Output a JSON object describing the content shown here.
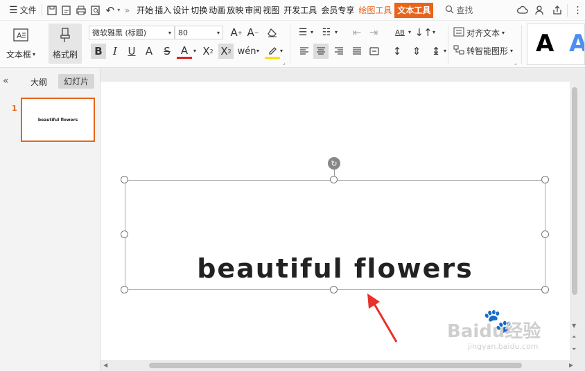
{
  "menu": {
    "label": "文件"
  },
  "tabs": [
    {
      "label": "开始"
    },
    {
      "label": "插入"
    },
    {
      "label": "设计"
    },
    {
      "label": "切换"
    },
    {
      "label": "动画"
    },
    {
      "label": "放映"
    },
    {
      "label": "审阅"
    },
    {
      "label": "视图"
    },
    {
      "label": "开发工具"
    },
    {
      "label": "会员专享"
    },
    {
      "label": "绘图工具"
    },
    {
      "label": "文本工具"
    }
  ],
  "search": {
    "label": "查找"
  },
  "ribbon": {
    "textbox_label": "文本框",
    "textbox_caret": "▾",
    "format_painter_label": "格式刷",
    "font_name": "微软雅黑 (标题)",
    "font_size": "80",
    "align_text_label": "对齐文本",
    "convert_smartart_label": "转智能图形",
    "style_glyph": "A"
  },
  "sidebar": {
    "outline_tab": "大纲",
    "slides_tab": "幻灯片",
    "slide_number": "1",
    "thumb_text": "beautiful flowers"
  },
  "slide": {
    "text": "beautiful flowers"
  },
  "watermark": {
    "brand": "Baidu经验",
    "url": "jingyan.baidu.com"
  },
  "colors": {
    "accent": "#e8641b",
    "arrow": "#e8312a"
  }
}
